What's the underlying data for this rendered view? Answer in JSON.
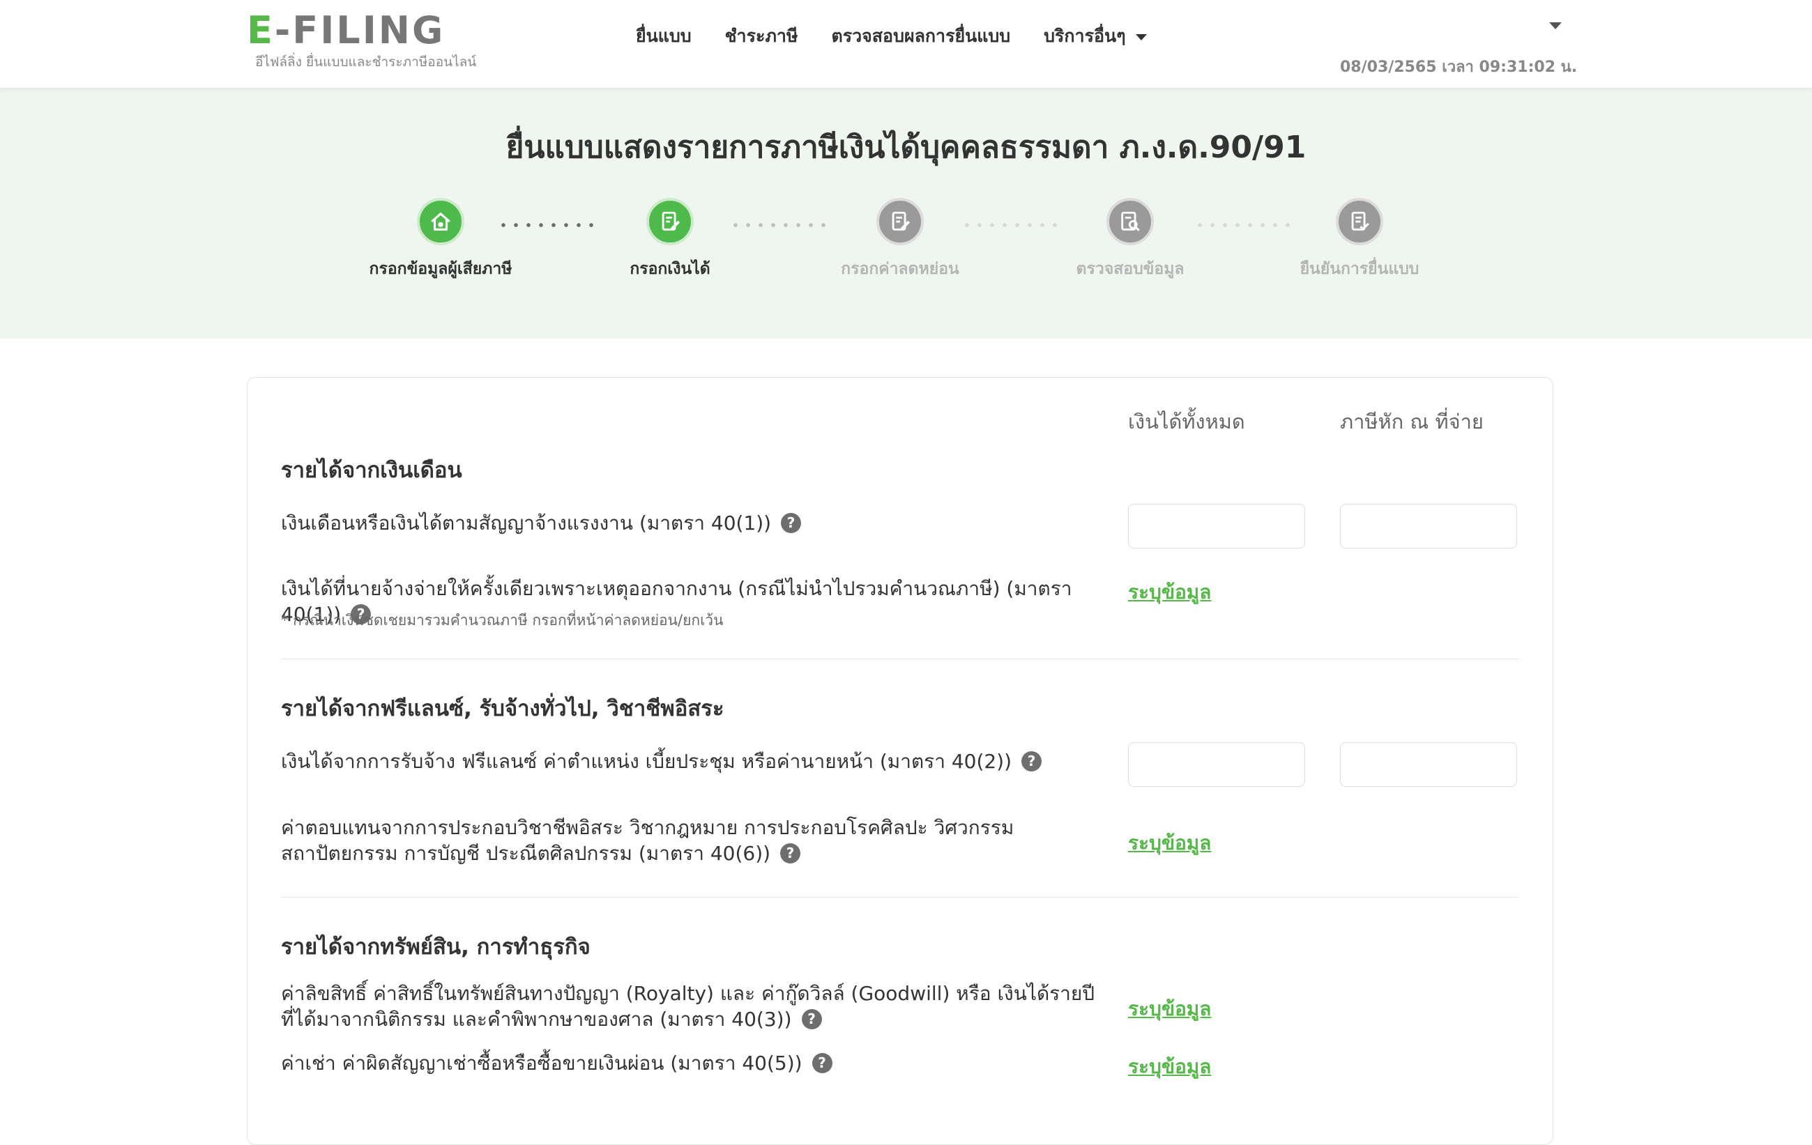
{
  "header": {
    "logo_text": "E-FILING",
    "logo_prefix": "E",
    "logo_rest": "-FILING",
    "logo_tagline": "อีไฟล์ลิ่ง ยื่นแบบและชำระภาษีออนไลน์",
    "nav": [
      "ยื่นแบบ",
      "ชำระภาษี",
      "ตรวจสอบผลการยื่นแบบ",
      "บริการอื่นๆ"
    ],
    "datetime": "08/03/2565 เวลา 09:31:02 น."
  },
  "hero": {
    "title": "ยื่นแบบแสดงรายการภาษีเงินได้บุคคลธรรมดา ภ.ง.ด.90/91",
    "steps": [
      {
        "label": "กรอกข้อมูลผู้เสียภาษี",
        "state": "active",
        "icon": "house-icon"
      },
      {
        "label": "กรอกเงินได้",
        "state": "active",
        "icon": "document-edit-icon"
      },
      {
        "label": "กรอกค่าลดหย่อน",
        "state": "inactive",
        "icon": "document-edit-icon"
      },
      {
        "label": "ตรวจสอบข้อมูล",
        "state": "inactive",
        "icon": "document-search-icon"
      },
      {
        "label": "ยืนยันการยื่นแบบ",
        "state": "inactive",
        "icon": "document-check-icon"
      }
    ]
  },
  "form": {
    "columns": {
      "total_income": "เงินได้ทั้งหมด",
      "withholding_tax": "ภาษีหัก ณ ที่จ่าย"
    },
    "help_symbol": "?",
    "specify_link": "ระบุข้อมูล",
    "sections": {
      "salary": {
        "title": "รายได้จากเงินเดือน",
        "row1": "เงินเดือนหรือเงินได้ตามสัญญาจ้างแรงงาน (มาตรา 40(1))",
        "row2": "เงินได้ที่นายจ้างจ่ายให้ครั้งเดียวเพราะเหตุออกจากงาน (กรณีไม่นำไปรวมคำนวณภาษี) (มาตรา 40(1))",
        "row2_note": "* กรณีนำเงินชดเชยมารวมคำนวณภาษี กรอกที่หน้าค่าลดหย่อน/ยกเว้น"
      },
      "freelance": {
        "title": "รายได้จากฟรีแลนซ์, รับจ้างทั่วไป, วิชาชีพอิสระ",
        "row1": "เงินได้จากการรับจ้าง ฟรีแลนซ์ ค่าตำแหน่ง เบี้ยประชุม หรือค่านายหน้า (มาตรา 40(2))",
        "row2": "ค่าตอบแทนจากการประกอบวิชาชีพอิสระ วิชากฎหมาย การประกอบโรคศิลปะ วิศวกรรม สถาปัตยกรรม การบัญชี ประณีตศิลปกรรม (มาตรา 40(6))"
      },
      "assets": {
        "title": "รายได้จากทรัพย์สิน, การทำธุรกิจ",
        "row1": "ค่าลิขสิทธิ์ ค่าสิทธิ์ในทรัพย์สินทางปัญญา (Royalty) และ ค่ากู๊ดวิลล์ (Goodwill) หรือ เงินได้รายปีที่ได้มาจากนิติกรรม และคำพิพากษาของศาล (มาตรา 40(3))",
        "row2": "ค่าเช่า ค่าผิดสัญญาเช่าซื้อหรือซื้อขายเงินผ่อน (มาตรา 40(5))"
      }
    }
  },
  "colors": {
    "brand_green": "#56b848",
    "hero_bg": "#eff6ef",
    "inactive_gray": "#9a9a9a"
  }
}
